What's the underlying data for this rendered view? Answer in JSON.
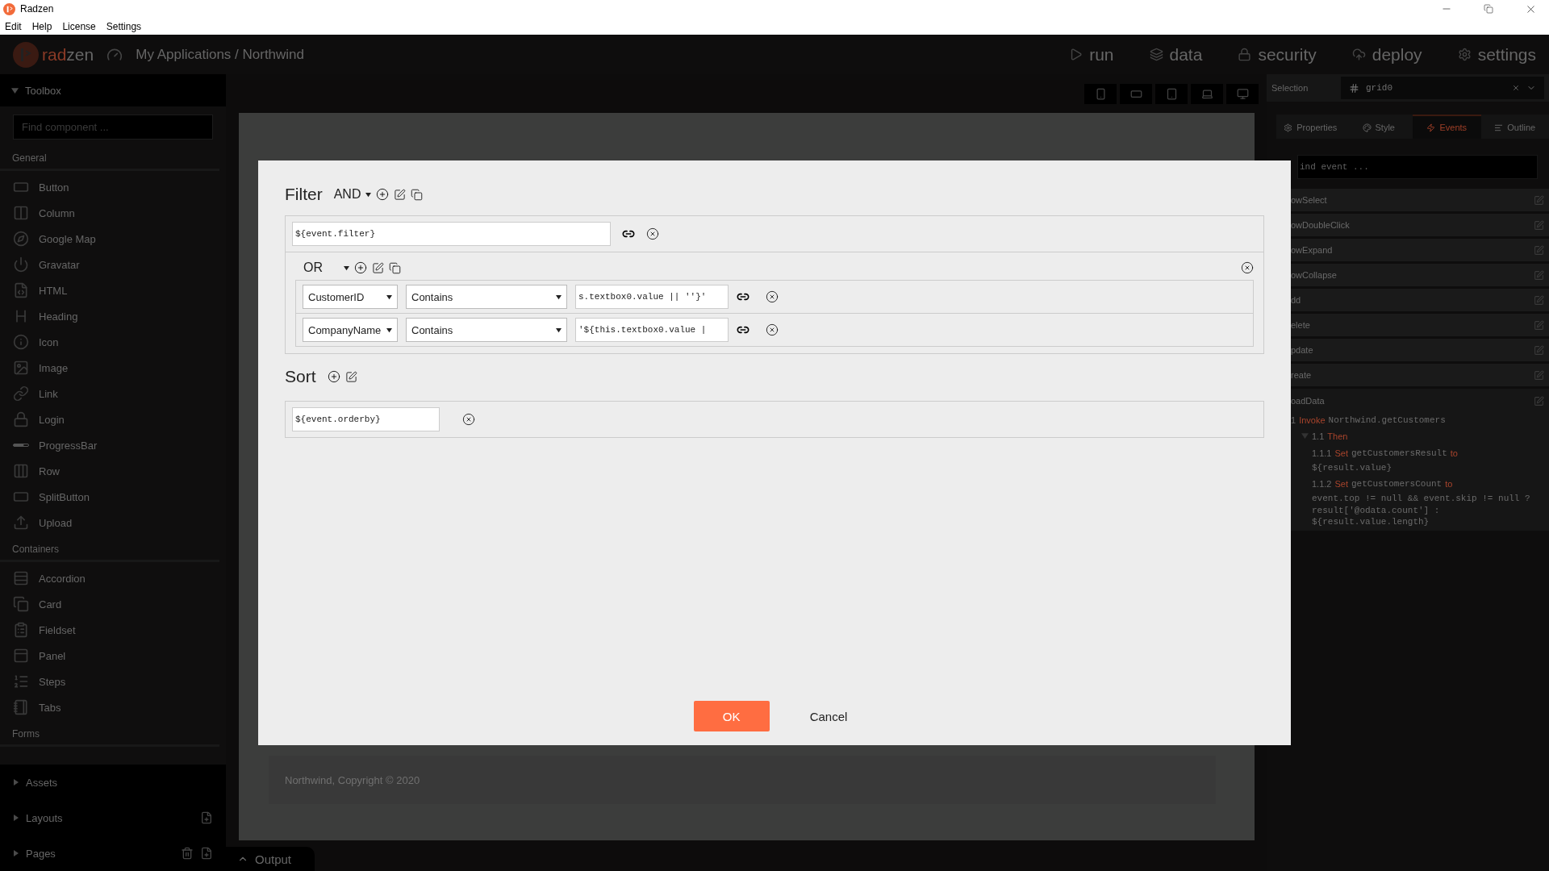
{
  "window": {
    "title": "Radzen"
  },
  "menu": [
    "Edit",
    "Help",
    "License",
    "Settings"
  ],
  "header": {
    "logo_primary": "rad",
    "logo_secondary": "zen",
    "breadcrumb": "My Applications / Northwind",
    "nav": [
      {
        "label": "run"
      },
      {
        "label": "data"
      },
      {
        "label": "security"
      },
      {
        "label": "deploy"
      },
      {
        "label": "settings"
      }
    ]
  },
  "toolbox": {
    "title": "Toolbox",
    "expanded": true,
    "search_placeholder": "Find component ...",
    "sections": [
      {
        "title": "General",
        "items": [
          "Button",
          "Column",
          "Google Map",
          "Gravatar",
          "HTML",
          "Heading",
          "Icon",
          "Image",
          "Link",
          "Login",
          "ProgressBar",
          "Row",
          "SplitButton",
          "Upload"
        ]
      },
      {
        "title": "Containers",
        "items": [
          "Accordion",
          "Card",
          "Fieldset",
          "Panel",
          "Steps",
          "Tabs"
        ]
      },
      {
        "title": "Forms"
      }
    ]
  },
  "bottom_panels": [
    {
      "label": "Assets",
      "expanded": false
    },
    {
      "label": "Layouts",
      "expanded": false
    },
    {
      "label": "Pages",
      "expanded": false
    }
  ],
  "canvas": {
    "footer": "Northwind, Copyright © 2020"
  },
  "output_tab": {
    "label": "Output"
  },
  "selection": {
    "label": "Selection",
    "value": "grid0"
  },
  "inspector_tabs": [
    {
      "label": "Properties",
      "selected": false
    },
    {
      "label": "Style",
      "selected": false
    },
    {
      "label": "Events",
      "selected": true
    },
    {
      "label": "Outline",
      "selected": false
    }
  ],
  "events": {
    "search_placeholder": "ind event ...",
    "items": [
      {
        "name": "owSelect"
      },
      {
        "name": "owDoubleClick"
      },
      {
        "name": "owExpand"
      },
      {
        "name": "owCollapse"
      },
      {
        "name": "dd"
      },
      {
        "name": "elete"
      },
      {
        "name": "pdate"
      },
      {
        "name": "reate"
      },
      {
        "name": "oadData",
        "actions": [
          {
            "number": "1",
            "verb": "Invoke",
            "target": "Northwind.getCustomers",
            "children": [
              {
                "number": "1.1",
                "verb": "Then",
                "expanded": true,
                "children": [
                  {
                    "number": "1.1.1",
                    "verb": "Set",
                    "target": "getCustomersResult",
                    "connector": "to",
                    "value": "${result.value}"
                  },
                  {
                    "number": "1.1.2",
                    "verb": "Set",
                    "target": "getCustomersCount",
                    "connector": "to",
                    "value": "event.top != null && event.skip != null ? result['@odata.count'] : ${result.value.length}"
                  }
                ]
              }
            ]
          }
        ]
      }
    ]
  },
  "dialog": {
    "filter": {
      "title": "Filter",
      "operator": "AND",
      "expression": "${event.filter}",
      "group": {
        "operator": "OR",
        "rows": [
          {
            "field": "CustomerID",
            "operator": "Contains",
            "value": "s.textbox0.value || ''}'"
          },
          {
            "field": "CompanyName",
            "operator": "Contains",
            "value": "'${this.textbox0.value |"
          }
        ]
      }
    },
    "sort": {
      "title": "Sort",
      "expression": "${event.orderby}"
    },
    "buttons": [
      {
        "label": "OK",
        "kind": "primary"
      },
      {
        "label": "Cancel",
        "kind": "link"
      }
    ]
  }
}
